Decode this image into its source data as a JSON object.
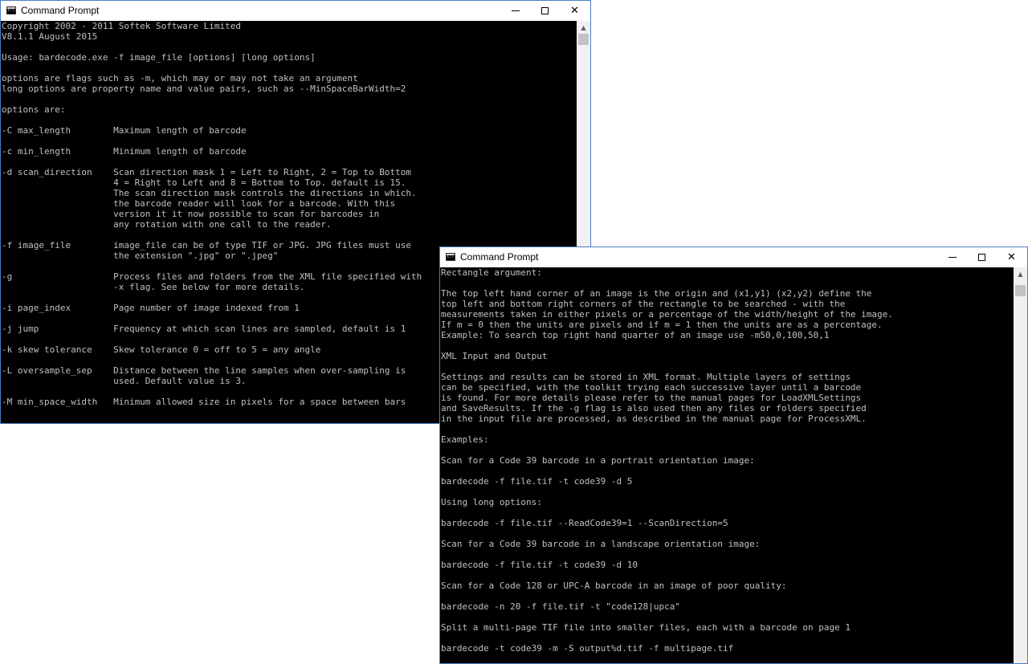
{
  "windows": [
    {
      "title": "Command Prompt",
      "lines": [
        "Copyright 2002 - 2011 Softek Software Limited",
        "V8.1.1 August 2015",
        "",
        "Usage: bardecode.exe -f image_file [options] [long options]",
        "",
        "options are flags such as -m, which may or may not take an argument",
        "long options are property name and value pairs, such as --MinSpaceBarWidth=2",
        "",
        "options are:",
        "",
        "-C max_length        Maximum length of barcode",
        "",
        "-c min_length        Minimum length of barcode",
        "",
        "-d scan_direction    Scan direction mask 1 = Left to Right, 2 = Top to Bottom",
        "                     4 = Right to Left and 8 = Bottom to Top. default is 15.",
        "                     The scan direction mask controls the directions in which.",
        "                     the barcode reader will look for a barcode. With this",
        "                     version it it now possible to scan for barcodes in",
        "                     any rotation with one call to the reader.",
        "",
        "-f image_file        image_file can be of type TIF or JPG. JPG files must use",
        "                     the extension \".jpg\" or \".jpeg\"",
        "",
        "-g                   Process files and folders from the XML file specified with",
        "                     -x flag. See below for more details.",
        "",
        "-i page_index        Page number of image indexed from 1",
        "",
        "-j jump              Frequency at which scan lines are sampled, default is 1",
        "",
        "-k skew tolerance    Skew tolerance 0 = off to 5 = any angle",
        "",
        "-L oversample_sep    Distance between the line samples when over-sampling is",
        "                     used. Default value is 3.",
        "",
        "-M min_space_width   Minimum allowed size in pixels for a space between bars"
      ]
    },
    {
      "title": "Command Prompt",
      "lines": [
        "Rectangle argument:",
        "",
        "The top left hand corner of an image is the origin and (x1,y1) (x2,y2) define the",
        "top left and bottom right corners of the rectangle to be searched - with the",
        "measurements taken in either pixels or a percentage of the width/height of the image.",
        "If m = 0 then the units are pixels and if m = 1 then the units are as a percentage.",
        "Example: To search top right hand quarter of an image use -m50,0,100,50,1",
        "",
        "XML Input and Output",
        "",
        "Settings and results can be stored in XML format. Multiple layers of settings",
        "can be specified, with the toolkit trying each successive layer until a barcode",
        "is found. For more details please refer to the manual pages for LoadXMLSettings",
        "and SaveResults. If the -g flag is also used then any files or folders specified",
        "in the input file are processed, as described in the manual page for ProcessXML.",
        "",
        "Examples:",
        "",
        "Scan for a Code 39 barcode in a portrait orientation image:",
        "",
        "bardecode -f file.tif -t code39 -d 5",
        "",
        "Using long options:",
        "",
        "bardecode -f file.tif --ReadCode39=1 --ScanDirection=5",
        "",
        "Scan for a Code 39 barcode in a landscape orientation image:",
        "",
        "bardecode -f file.tif -t code39 -d 10",
        "",
        "Scan for a Code 128 or UPC-A barcode in an image of poor quality:",
        "",
        "bardecode -n 20 -f file.tif -t \"code128|upca\"",
        "",
        "Split a multi-page TIF file into smaller files, each with a barcode on page 1",
        "",
        "bardecode -t code39 -m -S output%d.tif -f multipage.tif",
        ""
      ]
    }
  ]
}
